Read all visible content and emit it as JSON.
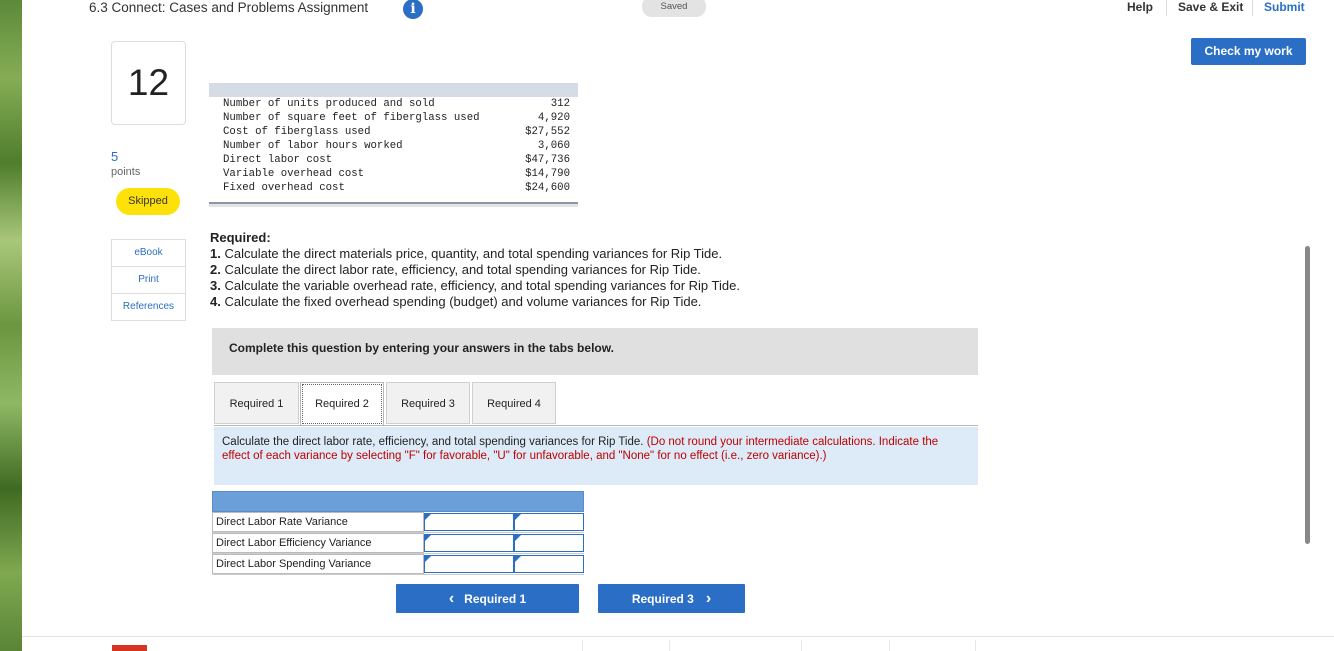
{
  "header": {
    "title": "6.3 Connect: Cases and Problems Assignment",
    "info_icon": "i",
    "saved": "Saved",
    "help": "Help",
    "save_exit": "Save & Exit",
    "submit": "Submit",
    "check_work": "Check my work"
  },
  "question": {
    "number": "12",
    "points_value": "5",
    "points_label": "points",
    "status": "Skipped"
  },
  "resources": [
    "eBook",
    "Print",
    "References"
  ],
  "given_data": [
    {
      "label": "Number of units produced and sold",
      "value": "312"
    },
    {
      "label": "Number of square feet of fiberglass used",
      "value": "4,920"
    },
    {
      "label": "Cost of fiberglass used",
      "value": "$27,552"
    },
    {
      "label": "Number of labor hours worked",
      "value": "3,060"
    },
    {
      "label": "Direct labor cost",
      "value": "$47,736"
    },
    {
      "label": "Variable overhead cost",
      "value": "$14,790"
    },
    {
      "label": "Fixed overhead cost",
      "value": "$24,600"
    }
  ],
  "required": {
    "heading": "Required:",
    "items": [
      {
        "num": "1.",
        "text": "Calculate the direct materials price, quantity, and total spending variances for Rip Tide."
      },
      {
        "num": "2.",
        "text": "Calculate the direct labor rate, efficiency, and total spending variances for Rip Tide."
      },
      {
        "num": "3.",
        "text": "Calculate the variable overhead rate, efficiency, and total spending variances for Rip Tide."
      },
      {
        "num": "4.",
        "text": "Calculate the fixed overhead spending (budget) and volume variances for Rip Tide."
      }
    ]
  },
  "complete_prompt": "Complete this question by entering your answers in the tabs below.",
  "tabs": [
    "Required 1",
    "Required 2",
    "Required 3",
    "Required 4"
  ],
  "active_tab": "Required 2",
  "instruction": {
    "main": "Calculate the direct labor rate, efficiency, and total spending variances for Rip Tide.",
    "note": "(Do not round your intermediate calculations. Indicate the effect of each variance by selecting \"F\" for favorable, \"U\" for unfavorable, and \"None\" for no effect (i.e., zero variance).)"
  },
  "answer_rows": [
    {
      "label": "Direct Labor Rate Variance",
      "amount": "",
      "effect": ""
    },
    {
      "label": "Direct Labor Efficiency Variance",
      "amount": "",
      "effect": ""
    },
    {
      "label": "Direct Labor Spending Variance",
      "amount": "",
      "effect": ""
    }
  ],
  "navigation": {
    "prev": "Required 1",
    "next": "Required 3",
    "prev_icon": "‹",
    "next_icon": "›"
  }
}
